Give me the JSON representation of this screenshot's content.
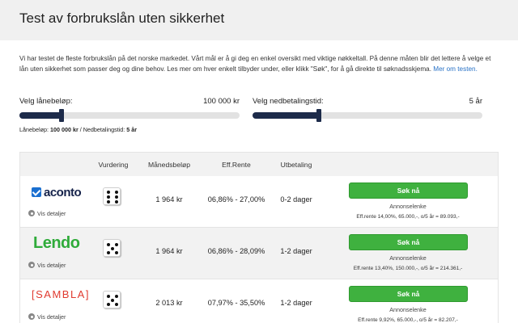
{
  "page": {
    "title": "Test av forbrukslån uten sikkerhet",
    "intro_text": "Vi har testet de fleste forbrukslån på det norske markedet. Vårt mål er å gi deg en enkel oversikt med viktige nøkkeltall. På denne måten blir det lettere å velge et lån uten sikkerhet som passer deg og dine behov. Les mer om hver enkelt tilbyder under, eller klikk \"Søk\", for å gå direkte til søknadsskjema. ",
    "intro_link": "Mer om testen."
  },
  "sliders": {
    "loan_amount": {
      "label": "Velg lånebeløp:",
      "value_text": "100 000 kr",
      "fraction": 0.19
    },
    "repayment_time": {
      "label": "Velg nedbetalingstid:",
      "value_text": "5 år",
      "fraction": 0.29
    }
  },
  "summary": {
    "prefix": "Lånebeløp: ",
    "amount": "100 000 kr",
    "separator": " / Nedbetalingstid: ",
    "term": "5 år"
  },
  "table": {
    "headers": {
      "rating": "Vurdering",
      "monthly": "Månedsbeløp",
      "rate": "Eff.Rente",
      "payout": "Utbetaling"
    },
    "rows": [
      {
        "lender": "aconto",
        "logo_icon": "checkbox-icon",
        "dice_value": 6,
        "details_label": "Vis detaljer",
        "monthly": "1 964 kr",
        "rate": "06,86% - 27,00%",
        "payout": "0-2 dager",
        "button_label": "Søk nå",
        "ad_label": "Annonselenke",
        "eff_text": "Eff.rente 14,00%, 65.000,-, o/5 år = 89.093,-"
      },
      {
        "lender": "Lendo",
        "dice_value": 5,
        "details_label": "Vis detaljer",
        "monthly": "1 964 kr",
        "rate": "06,86% - 28,09%",
        "payout": "1-2 dager",
        "button_label": "Søk nå",
        "ad_label": "Annonselenke",
        "eff_text": "Eff.rente 13,40%, 150.000,-, o/5 år = 214.361,-"
      },
      {
        "lender": "[SAMBLA]",
        "dice_value": 5,
        "details_label": "Vis detaljer",
        "monthly": "2 013 kr",
        "rate": "07,97% - 35,50%",
        "payout": "1-2 dager",
        "button_label": "Søk nå",
        "ad_label": "Annonselenke",
        "eff_text": "Eff.rente 9,92%, 65.000,-, o/5 år = 82.207,-"
      }
    ]
  },
  "colors": {
    "slider_fill": "#1d2b4a",
    "button_green": "#3fb13f",
    "aconto_blue": "#15224a",
    "lendo_green": "#2fab3a",
    "sambla_red": "#e03a2f",
    "link_blue": "#2a73c7"
  }
}
